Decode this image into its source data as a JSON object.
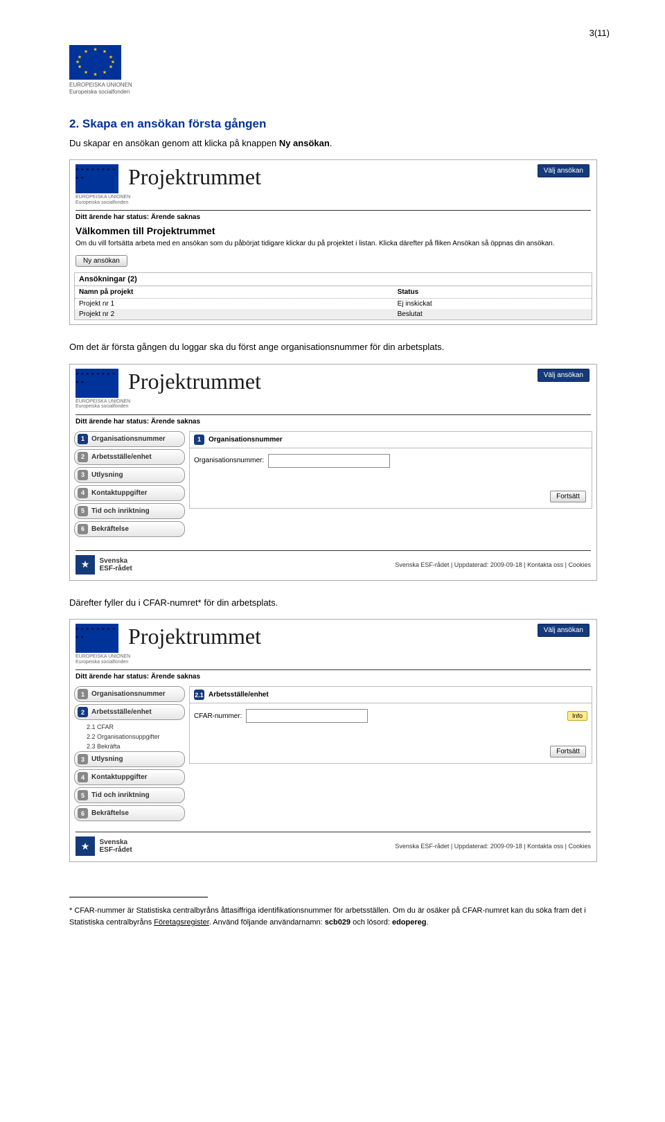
{
  "page_number": "3(11)",
  "eu_label_line1": "EUROPEISKA UNIONEN",
  "eu_label_line2": "Europeiska socialfonden",
  "section_title": "2. Skapa en ansökan första gången",
  "intro_prefix": "Du skapar en ansökan genom att klicka på knappen ",
  "intro_bold": "Ny ansökan",
  "intro_suffix": ".",
  "mid_text": "Om det är första gången du loggar ska du först ange organisationsnummer för din arbetsplats.",
  "after_text": "Därefter fyller du i CFAR-numret* för din arbetsplats.",
  "app": {
    "title": "Projektrummet",
    "top_button": "Välj ansökan",
    "eu_sub1": "EUROPEISKA UNIONEN",
    "eu_sub2": "Europeiska socialfonden",
    "status_line": "Ditt ärende har status: Ärende saknas"
  },
  "shot1": {
    "welcome_title": "Välkommen till Projektrummet",
    "welcome_desc": "Om du vill fortsätta arbeta med en ansökan som du påbörjat tidigare klickar du på projektet i listan. Klicka därefter på fliken Ansökan så öppnas din ansökan.",
    "new_button": "Ny ansökan",
    "table_title": "Ansökningar (2)",
    "col1": "Namn på projekt",
    "col2": "Status",
    "rows": [
      {
        "name": "Projekt nr 1",
        "status": "Ej inskickat"
      },
      {
        "name": "Projekt nr 2",
        "status": "Beslutat"
      }
    ]
  },
  "shot2": {
    "steps": [
      {
        "n": "1",
        "label": "Organisationsnummer",
        "active": true
      },
      {
        "n": "2",
        "label": "Arbetsställe/enhet",
        "active": false
      },
      {
        "n": "3",
        "label": "Utlysning",
        "active": false
      },
      {
        "n": "4",
        "label": "Kontaktuppgifter",
        "active": false
      },
      {
        "n": "5",
        "label": "Tid och inriktning",
        "active": false
      },
      {
        "n": "6",
        "label": "Bekräftelse",
        "active": false
      }
    ],
    "panel_num": "1",
    "panel_title": "Organisationsnummer",
    "field_label": "Organisationsnummer:",
    "continue": "Fortsätt",
    "footer_text": "Svenska ESF-rådet | Uppdaterad: 2009-09-18 | Kontakta oss | Cookies",
    "esf_line1": "Svenska",
    "esf_line2": "ESF-rådet"
  },
  "shot3": {
    "steps": [
      {
        "n": "1",
        "label": "Organisationsnummer"
      },
      {
        "n": "2",
        "label": "Arbetsställe/enhet"
      },
      {
        "n": "3",
        "label": "Utlysning"
      },
      {
        "n": "4",
        "label": "Kontaktuppgifter"
      },
      {
        "n": "5",
        "label": "Tid och inriktning"
      },
      {
        "n": "6",
        "label": "Bekräftelse"
      }
    ],
    "substeps": [
      "2.1 CFAR",
      "2.2 Organisationsuppgifter",
      "2.3 Bekräfta"
    ],
    "panel_num": "2.1",
    "panel_title": "Arbetsställe/enhet",
    "field_label": "CFAR-nummer:",
    "info": "Info",
    "continue": "Fortsätt",
    "footer_text": "Svenska ESF-rådet | Uppdaterad: 2009-09-18 | Kontakta oss | Cookies",
    "esf_line1": "Svenska",
    "esf_line2": "ESF-rådet"
  },
  "footnote": {
    "marker": "*",
    "text1": " CFAR-nummer är Statistiska centralbyråns åttasiffriga identifikationsnummer för arbetsställen. Om du är osäker på CFAR-numret kan du söka fram det i Statistiska centralbyråns ",
    "link": "Företagsregister",
    "text2": ". Använd följande användarnamn: ",
    "user": "scb029",
    "text3": " och lösord: ",
    "pass": "edopereg",
    "text4": "."
  }
}
